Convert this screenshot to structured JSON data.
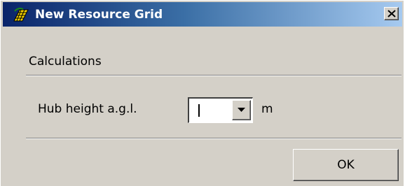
{
  "window": {
    "title": "New Resource Grid",
    "title_icon": "wind-resource-icon",
    "close_label": "X"
  },
  "section": {
    "label": "Calculations"
  },
  "hub_height": {
    "label": "Hub height a.g.l.",
    "value": "",
    "unit": "m"
  },
  "actions": {
    "ok_label": "OK"
  },
  "colors": {
    "title_gradient_start": "#0a246a",
    "title_gradient_end": "#a6caf0",
    "face": "#d4d0c8"
  }
}
